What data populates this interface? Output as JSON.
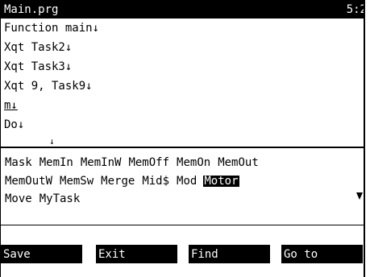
{
  "title_bar": {
    "filename": "Main.prg",
    "position": "5:2"
  },
  "editor": {
    "lines": [
      "Function main↓",
      "Xqt Task2↓",
      "Xqt Task3↓",
      "Xqt 9, Task9↓",
      "m↓",
      "Do↓"
    ],
    "cursor_glyph": "↓"
  },
  "keywords": {
    "rows": [
      [
        "Mask",
        "MemIn",
        "MemInW",
        "MemOff",
        "MemOn",
        "MemOut"
      ],
      [
        "MemOutW",
        "MemSw",
        "Merge",
        "Mid$",
        "Mod",
        "Motor"
      ],
      [
        "Move",
        "MyTask"
      ]
    ],
    "selected": "Motor"
  },
  "function_keys": [
    {
      "label": "Save"
    },
    {
      "label": "Exit"
    },
    {
      "label": "Find"
    },
    {
      "label": "Go to"
    }
  ],
  "icons": {
    "more_arrow": "scroll-down-arrow-icon"
  },
  "colors": {
    "background": "#ffffff",
    "foreground": "#000000"
  }
}
